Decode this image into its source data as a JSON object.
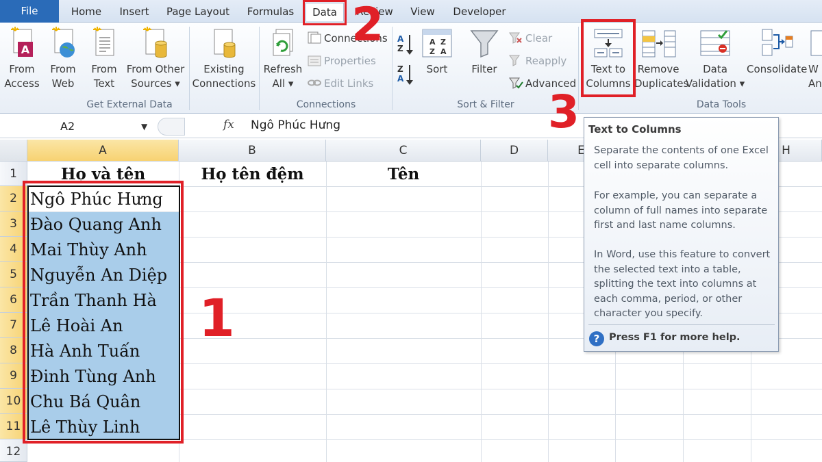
{
  "tabs": [
    "File",
    "Home",
    "Insert",
    "Page Layout",
    "Formulas",
    "Data",
    "Review",
    "View",
    "Developer"
  ],
  "ribbon": {
    "get_external": {
      "from_access": [
        "From",
        "Access"
      ],
      "from_web": [
        "From",
        "Web"
      ],
      "from_text": [
        "From",
        "Text"
      ],
      "from_other": [
        "From Other",
        "Sources ▾"
      ],
      "existing": [
        "Existing",
        "Connections"
      ],
      "label": "Get External Data"
    },
    "connections": {
      "refresh": [
        "Refresh",
        "All ▾"
      ],
      "connections": "Connections",
      "properties": "Properties",
      "edit_links": "Edit Links",
      "label": "Connections"
    },
    "sort_filter": {
      "sort": "Sort",
      "filter": "Filter",
      "clear": "Clear",
      "reapply": "Reapply",
      "advanced": "Advanced",
      "label": "Sort & Filter"
    },
    "data_tools": {
      "text_to_columns": [
        "Text to",
        "Columns"
      ],
      "remove_duplicates": [
        "Remove",
        "Duplicates"
      ],
      "data_validation": [
        "Data",
        "Validation ▾"
      ],
      "consolidate": "Consolidate",
      "whatif": [
        "W",
        "An"
      ],
      "label": "Data Tools"
    }
  },
  "formula_bar": {
    "name_box": "A2",
    "fx": "fx",
    "content": "Ngô Phúc Hưng"
  },
  "columns": [
    "A",
    "B",
    "C",
    "D",
    "E",
    "H"
  ],
  "rows": [
    "1",
    "2",
    "3",
    "4",
    "5",
    "6",
    "7",
    "8",
    "9",
    "10",
    "11",
    "12"
  ],
  "headers": {
    "a1": "Họ và tên",
    "b1": "Họ tên đệm",
    "c1": "Tên"
  },
  "names": [
    "Ngô Phúc Hưng",
    "Đào Quang Anh",
    "Mai Thùy Anh",
    "Nguyễn An Diệp",
    "Trần Thanh Hà",
    "Lê Hoài An",
    "Hà Anh Tuấn",
    "Đinh Tùng Anh",
    "Chu Bá Quân",
    "Lê Thùy Linh"
  ],
  "tooltip": {
    "title": "Text to Columns",
    "p1": "Separate the contents of one Excel cell into separate columns.",
    "p2": "For example, you can separate a column of full names into separate first and last name columns.",
    "p3": "In Word, use this feature to convert the selected text into a table, splitting the text into columns at each comma, period, or other character you specify.",
    "help": "Press F1 for more help."
  },
  "steps": [
    "1",
    "2",
    "3"
  ],
  "colors": {
    "accent_red": "#e02027",
    "selection_blue": "#a9cdea",
    "file_tab": "#2a6bb8"
  }
}
